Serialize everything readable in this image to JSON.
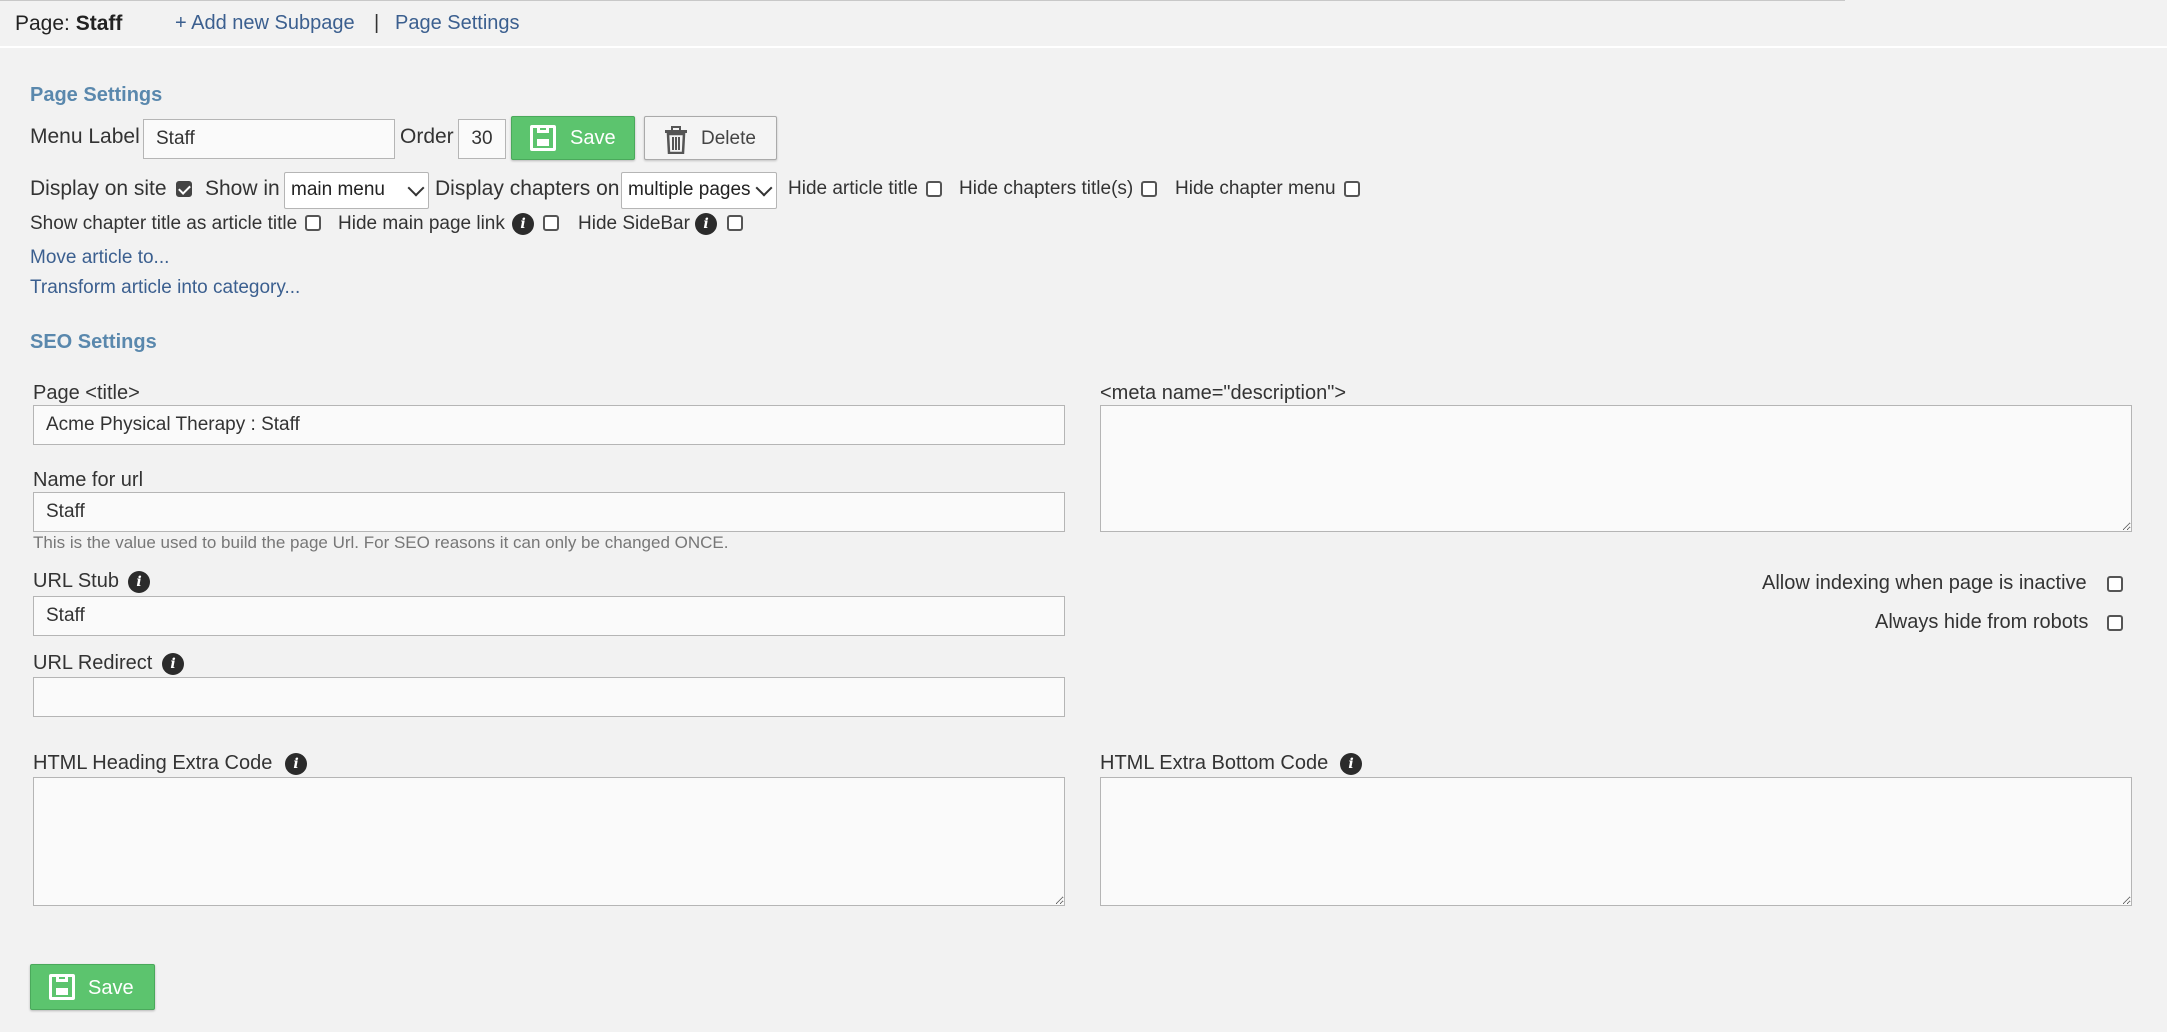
{
  "header": {
    "page_prefix": "Page:",
    "page_name": "Staff",
    "add_subpage": "+ Add new Subpage",
    "separator": "|",
    "page_settings_link": "Page Settings"
  },
  "page_settings": {
    "title": "Page Settings",
    "menu_label": "Menu Label",
    "menu_label_value": "Staff",
    "order_label": "Order",
    "order_value": "30",
    "save_label": "Save",
    "delete_label": "Delete",
    "display_on_site": "Display on site",
    "display_on_site_checked": true,
    "show_in": "Show in",
    "show_in_value": "main menu",
    "display_chapters_on": "Display chapters on",
    "display_chapters_value": "multiple pages",
    "hide_article_title": "Hide article title",
    "hide_chapters_titles": "Hide chapters title(s)",
    "hide_chapter_menu": "Hide chapter menu",
    "show_chapter_title": "Show chapter title as article title",
    "hide_main_page_link": "Hide main page link",
    "hide_sidebar": "Hide SideBar",
    "move_article": "Move article to...",
    "transform_article": "Transform article into category..."
  },
  "seo": {
    "title": "SEO Settings",
    "page_title_label": "Page <title>",
    "page_title_value": "Acme Physical Therapy : Staff",
    "meta_desc_label": "<meta name=\"description\">",
    "meta_desc_value": "",
    "name_for_url_label": "Name for url",
    "name_for_url_value": "Staff",
    "name_for_url_hint": "This is the value used to build the page Url. For SEO reasons it can only be changed ONCE.",
    "url_stub_label": "URL Stub",
    "url_stub_value": "Staff",
    "url_redirect_label": "URL Redirect",
    "url_redirect_value": "",
    "allow_indexing": "Allow indexing when page is inactive",
    "always_hide_robots": "Always hide from robots",
    "html_heading_label": "HTML Heading Extra Code",
    "html_bottom_label": "HTML Extra Bottom Code"
  },
  "footer": {
    "save_label": "Save"
  },
  "colors": {
    "save_green": "#5cc46e",
    "link_blue": "#3b5f8f",
    "section_title": "#5a88ad"
  }
}
